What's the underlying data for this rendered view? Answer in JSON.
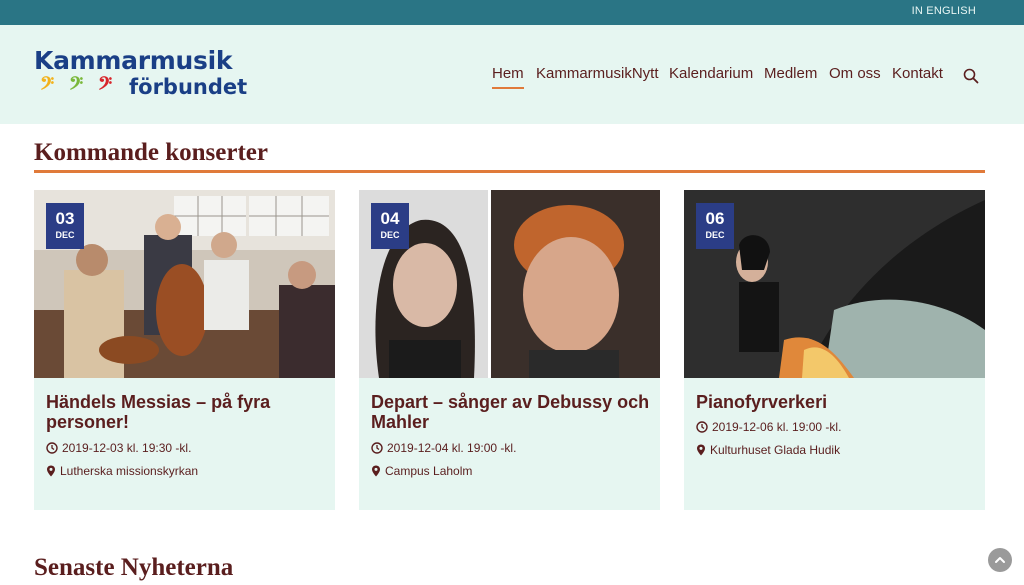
{
  "topbar": {
    "language_link": "IN ENGLISH"
  },
  "header": {
    "logo": {
      "line1": "Kammarmusik",
      "line2": "förbundet"
    },
    "nav": [
      {
        "label": "Hem",
        "active": true
      },
      {
        "label": "KammarmusikNytt",
        "active": false
      },
      {
        "label": "Kalendarium",
        "active": false
      },
      {
        "label": "Medlem",
        "active": false
      },
      {
        "label": "Om oss",
        "active": false
      },
      {
        "label": "Kontakt",
        "active": false
      }
    ]
  },
  "concerts": {
    "heading": "Kommande konserter",
    "cards": [
      {
        "day": "03",
        "month": "DEC",
        "title": "Händels Messias – på fyra personer!",
        "datetime": "2019-12-03 kl. 19:30 -kl.",
        "venue": "Lutherska missionskyrkan"
      },
      {
        "day": "04",
        "month": "DEC",
        "title": "Depart – sånger av Debussy och Mahler",
        "datetime": "2019-12-04 kl. 19:00 -kl.",
        "venue": "Campus Laholm"
      },
      {
        "day": "06",
        "month": "DEC",
        "title": "Pianofyrverkeri",
        "datetime": "2019-12-06 kl. 19:00 -kl.",
        "venue": "Kulturhuset Glada Hudik"
      }
    ]
  },
  "news": {
    "heading": "Senaste Nyheterna"
  },
  "colors": {
    "topbar": "#2a7585",
    "header_bg": "#e6f6f1",
    "accent": "#e07a3a",
    "text": "#5a1e1e",
    "badge": "#2b3d86",
    "logo": "#1a3f86"
  },
  "icons": {
    "search": "search-icon",
    "clock": "clock-icon",
    "pin": "map-pin-icon",
    "back_to_top": "chevron-up-icon"
  }
}
